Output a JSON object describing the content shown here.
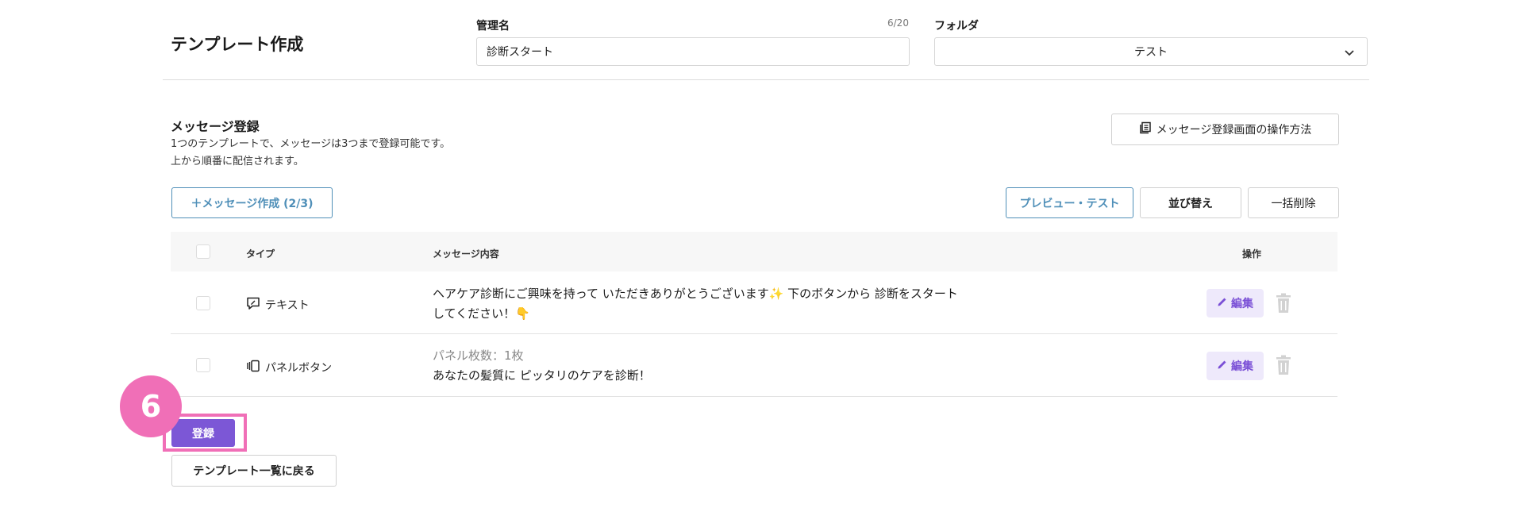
{
  "header": {
    "page_title": "テンプレート作成",
    "name_label": "管理名",
    "name_counter": "6/20",
    "name_value": "診断スタート",
    "folder_label": "フォルダ",
    "folder_value": "テスト"
  },
  "messages_section": {
    "title": "メッセージ登録",
    "desc_line1": "1つのテンプレートで、メッセージは3つまで登録可能です。",
    "desc_line2": "上から順番に配信されます。",
    "howto_button": "メッセージ登録画面の操作方法",
    "create_button": "＋メッセージ作成 (2/3)",
    "preview_button": "プレビュー・テスト",
    "sort_button": "並び替え",
    "bulk_delete_button": "一括削除"
  },
  "table": {
    "headers": {
      "type": "タイプ",
      "content": "メッセージ内容",
      "actions": "操作"
    },
    "rows": [
      {
        "type": "テキスト",
        "type_icon": "text-message-icon",
        "line1": "ヘアケア診断にご興味を持って いただきありがとうございます✨ 下のボタンから 診断をスタート",
        "line2": "してください！👇",
        "edit_label": "編集"
      },
      {
        "type": "パネルボタン",
        "type_icon": "panel-carousel-icon",
        "sub": "パネル枚数：1枚",
        "line1": "あなたの髪質に ピッタリのケアを診断！",
        "edit_label": "編集"
      }
    ]
  },
  "footer": {
    "step_badge": "6",
    "submit_button": "登録",
    "back_button": "テンプレート一覧に戻る"
  },
  "colors": {
    "accent_purple": "#7c57d6",
    "highlight_pink": "#f06fb7",
    "outline_blue": "#4f8fb8"
  }
}
